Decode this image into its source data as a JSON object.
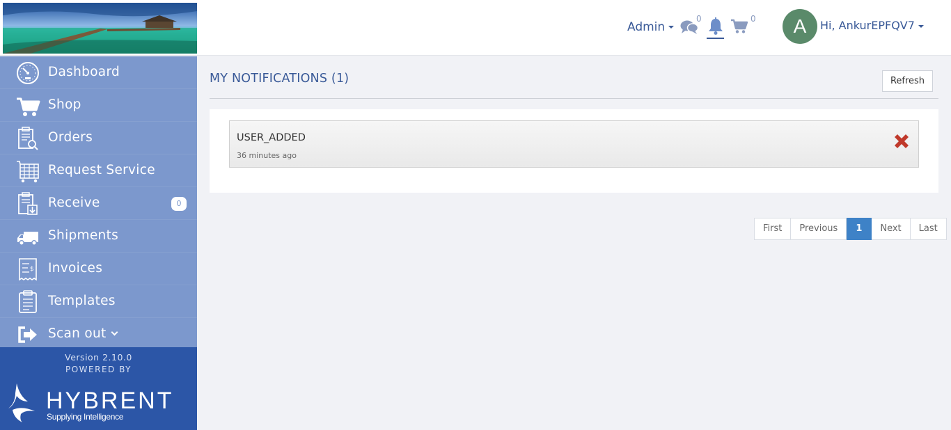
{
  "header": {
    "admin_label": "Admin",
    "messages_count": "0",
    "cart_count": "0",
    "avatar_letter": "A",
    "user_greeting": "Hi, AnkurEPFQV7"
  },
  "sidebar": {
    "items": [
      {
        "label": "Dashboard",
        "icon": "dashboard-icon"
      },
      {
        "label": "Shop",
        "icon": "cart-icon"
      },
      {
        "label": "Orders",
        "icon": "orders-icon"
      },
      {
        "label": "Request Service",
        "icon": "request-service-icon"
      },
      {
        "label": "Receive",
        "icon": "receive-icon",
        "badge": "0"
      },
      {
        "label": "Shipments",
        "icon": "truck-icon"
      },
      {
        "label": "Invoices",
        "icon": "invoice-icon"
      },
      {
        "label": "Templates",
        "icon": "templates-icon"
      },
      {
        "label": "Scan out",
        "icon": "scan-out-icon"
      }
    ],
    "version": "Version 2.10.0",
    "powered_by": "POWERED BY",
    "brand_name": "HYBRENT",
    "brand_tagline": "Supplying Intelligence"
  },
  "main": {
    "title": "MY NOTIFICATIONS (1)",
    "refresh_label": "Refresh",
    "notifications": [
      {
        "title": "USER_ADDED",
        "time": "36 minutes ago"
      }
    ],
    "pagination": {
      "first": "First",
      "previous": "Previous",
      "current": "1",
      "next": "Next",
      "last": "Last"
    }
  },
  "colors": {
    "sidebar_bg": "#7c98cd",
    "sidebar_footer_bg": "#2c56a7",
    "accent": "#3a5a98",
    "pagination_active": "#3e82c7",
    "delete_icon": "#c0392b"
  }
}
